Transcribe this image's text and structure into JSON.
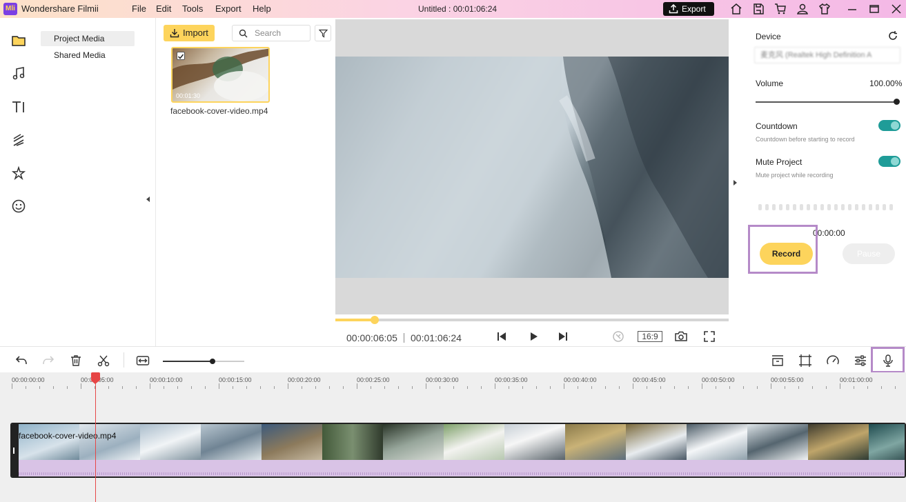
{
  "app": {
    "logo_text": "Mli",
    "name": "Wondershare Filmii",
    "menu": [
      "File",
      "Edit",
      "Tools",
      "Export",
      "Help"
    ],
    "document_title": "Untitled :",
    "document_duration": "00:01:06:24",
    "export_label": "Export",
    "accent_color": "#fdd45c"
  },
  "sidebar": {
    "items": [
      {
        "label": "Project Media",
        "active": true
      },
      {
        "label": "Shared Media",
        "active": false
      }
    ]
  },
  "media": {
    "import_label": "Import",
    "search_placeholder": "Search",
    "items": [
      {
        "name": "facebook-cover-video.mp4",
        "duration": "00:01:30",
        "selected": true
      }
    ]
  },
  "preview": {
    "current_time": "00:00:06:05",
    "total_time": "00:01:06:24",
    "progress_fraction": 0.1,
    "aspect_ratio": "16:9"
  },
  "record_panel": {
    "device_label": "Device",
    "device_value": "麦克风 (Realtek High Definition A",
    "volume_label": "Volume",
    "volume_value": "100.00%",
    "volume_fraction": 1.0,
    "countdown_label": "Countdown",
    "countdown_desc": "Countdown before starting to record",
    "countdown_on": true,
    "mute_label": "Mute Project",
    "mute_desc": "Mute project while recording",
    "mute_on": true,
    "record_time": "00:00:00",
    "record_label": "Record",
    "pause_label": "Pause"
  },
  "toolbar": {
    "zoom_fraction": 0.61
  },
  "timeline": {
    "ruler_labels": [
      "00:00:00:00",
      "00:00:05:00",
      "00:00:10:00",
      "00:00:15:00",
      "00:00:20:00",
      "00:00:25:00",
      "00:00:30:00",
      "00:00:35:00",
      "00:00:40:00",
      "00:00:45:00",
      "00:00:50:00",
      "00:00:55:00",
      "00:01:00:00"
    ],
    "clip_name": "facebook-cover-video.mp4",
    "playhead_time": "00:00:06:05"
  }
}
